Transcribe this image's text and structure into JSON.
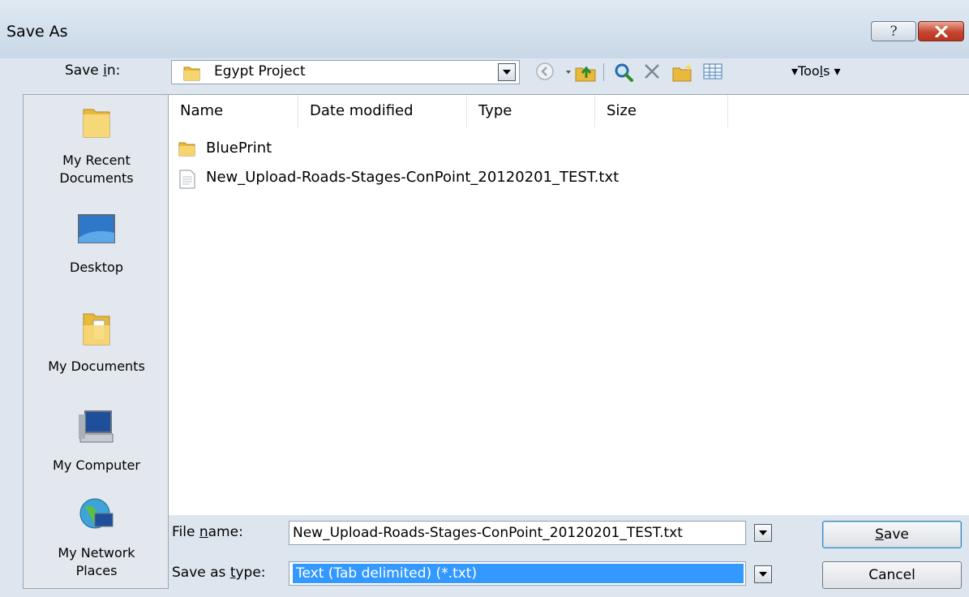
{
  "window": {
    "title": "Save As"
  },
  "save_in": {
    "label": "Save ",
    "label_key": "i",
    "label_rest": "n:",
    "location": "Egypt Project"
  },
  "toolbar": {
    "tools_label": "▾Too",
    "tools_key": "l",
    "tools_rest": "s ▾"
  },
  "places": [
    {
      "label_1": "My Recent",
      "label_2": "Documents",
      "icon": "recent-documents-icon"
    },
    {
      "label_1": "Desktop",
      "label_2": "",
      "icon": "desktop-icon"
    },
    {
      "label_1": "My Documents",
      "label_2": "",
      "icon": "my-documents-icon"
    },
    {
      "label_1": "My Computer",
      "label_2": "",
      "icon": "my-computer-icon"
    },
    {
      "label_1": "My Network",
      "label_2": "Places",
      "icon": "network-places-icon"
    }
  ],
  "columns": [
    "Name",
    "Date modified",
    "Type",
    "Size"
  ],
  "files": [
    {
      "name": "BluePrint",
      "icon": "folder-icon"
    },
    {
      "name": "New_Upload-Roads-Stages-ConPoint_20120201_TEST.txt",
      "icon": "text-file-icon"
    }
  ],
  "file_name": {
    "label_a": "File ",
    "label_key": "n",
    "label_b": "ame:",
    "value": "New_Upload-Roads-Stages-ConPoint_20120201_TEST.txt"
  },
  "file_type": {
    "label_a": "Save as ",
    "label_key": "t",
    "label_b": "ype:",
    "value": "Text (Tab delimited) (*.txt)"
  },
  "buttons": {
    "save_key": "S",
    "save_rest": "ave",
    "cancel": "Cancel"
  },
  "colors": {
    "selection": "#3399ff",
    "close": "#c5452f",
    "folder": "#e8b93a"
  }
}
